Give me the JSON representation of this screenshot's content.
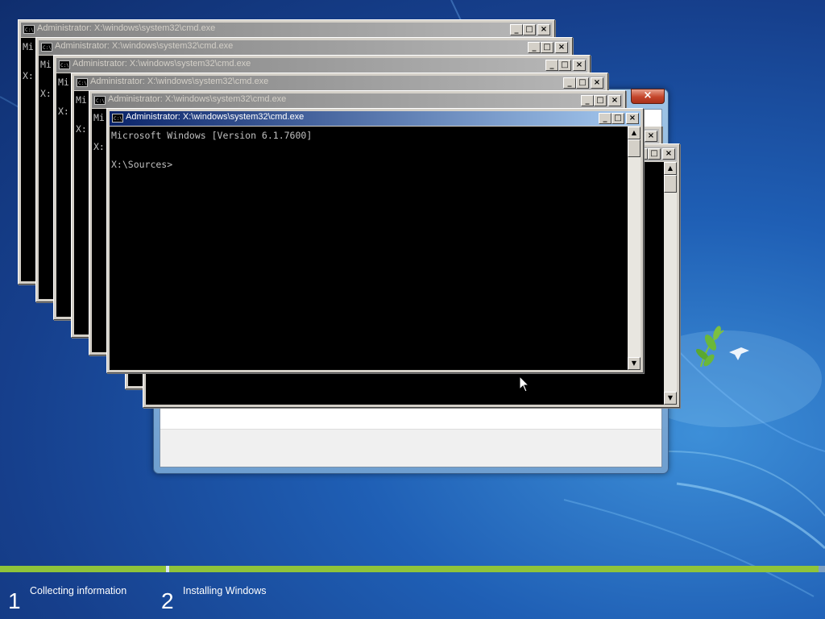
{
  "cmd_windows": [
    {
      "title": "Administrator: X:\\windows\\system32\\cmd.exe",
      "lines": [
        "Mi",
        "",
        "X:"
      ]
    },
    {
      "title": "Administrator: X:\\windows\\system32\\cmd.exe",
      "lines": [
        "Mi",
        "",
        "X:"
      ]
    },
    {
      "title": "Administrator: X:\\windows\\system32\\cmd.exe",
      "lines": [
        "Mi",
        "",
        "X:"
      ]
    },
    {
      "title": "Administrator: X:\\windows\\system32\\cmd.exe",
      "lines": [
        "Mi",
        "",
        "X:"
      ]
    },
    {
      "title": "Administrator: X:\\windows\\system32\\cmd.exe",
      "lines": [
        "Mi",
        "",
        "X:"
      ]
    },
    {
      "title": "Administrator: X:\\windows\\system32\\cmd.exe",
      "lines": [
        "Microsoft Windows [Version 6.1.7600]",
        "",
        "X:\\Sources>"
      ]
    }
  ],
  "setup_window": {
    "close_glyph": "×"
  },
  "progress": {
    "steps": [
      {
        "number": "1",
        "label": "Collecting information"
      },
      {
        "number": "2",
        "label": "Installing Windows"
      }
    ],
    "step1_fraction": 1.0,
    "step2_fraction": 0.0
  },
  "colors": {
    "progress_done": "#8fc43a",
    "progress_track": "#7fa0c0"
  }
}
